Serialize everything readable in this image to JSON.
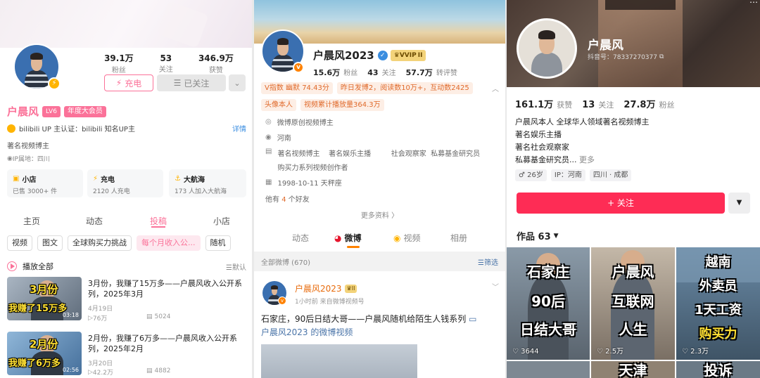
{
  "bili": {
    "stats": [
      {
        "num": "39.1万",
        "label": "粉丝"
      },
      {
        "num": "53",
        "label": "关注"
      },
      {
        "num": "346.9万",
        "label": "获赞"
      }
    ],
    "charge_btn": "充电",
    "followed_btn": "已关注",
    "more_icon": "chevron-down-icon",
    "name": "户晨风",
    "level": "LV6",
    "vip": "年度大会员",
    "cert": "bilibili UP 主认证：bilibili 知名UP主",
    "cert_detail": "详情",
    "bio": "著名视频博主",
    "ip": "IP属地：四川",
    "cards": [
      {
        "title": "小店",
        "sub": "已售 3000+ 件"
      },
      {
        "title": "充电",
        "sub": "2120 人充电"
      },
      {
        "title": "大航海",
        "sub": "173 人加入大航海"
      }
    ],
    "tabs": [
      "主页",
      "动态",
      "投稿",
      "小店"
    ],
    "filters": [
      "视频",
      "图文",
      "全球购买力挑战",
      "每个月收入公...",
      "随机"
    ],
    "play_all": "播放全部",
    "sort": "默认",
    "videos": [
      {
        "title": "3月份，我赚了15万多——户晨风收入公开系列，2025年3月",
        "date": "4月19日",
        "views": "76万",
        "danmaku": "5024",
        "dur": "03:18",
        "ov1": "3月份",
        "ov2": "我赚了15万多"
      },
      {
        "title": "2月份，我赚了6万多——户晨风收入公开系列，2025年2月",
        "date": "3月20日",
        "views": "42.2万",
        "danmaku": "4882",
        "dur": "02:56",
        "ov1": "2月份",
        "ov2": "我赚了6万多"
      }
    ]
  },
  "weibo": {
    "name": "户晨风2023",
    "vip": "VVIP",
    "vip_level": "II",
    "stats": [
      {
        "num": "15.6万",
        "label": "粉丝"
      },
      {
        "num": "43",
        "label": "关注"
      },
      {
        "num": "57.7万",
        "label": "转评赞"
      }
    ],
    "tag1": "V指数 幽默 74.43分",
    "tag2": "昨日发博2，阅读数10万+，互动数2425",
    "tag3": "头像本人",
    "tag4": "视频累计播放量364.3万",
    "info": [
      "微博原创视频博主",
      "河南",
      "著名视频博主    著名娱乐主播         社会观察家  私募基金研究员    购买力系列视频创作者",
      "1998-10-11 天秤座"
    ],
    "friends_pre": "他有",
    "friends_num": "4",
    "friends_post": "个好友",
    "more": "更多资料 〉",
    "tabs": [
      "动态",
      "微博",
      "视频",
      "相册"
    ],
    "all": "全部微博 (670)",
    "filter": "筛选",
    "post": {
      "name": "户晨风2023",
      "time": "1小时前  来自微博视频号",
      "text": "石家庄，90后日结大哥——户晨风随机给陌生人钱系列",
      "link": "户晨风2023 的微博视频"
    }
  },
  "douyin": {
    "name": "户晨风",
    "id": "抖音号：78337270377",
    "stats": [
      {
        "num": "161.1万",
        "label": "获赞"
      },
      {
        "num": "13",
        "label": "关注"
      },
      {
        "num": "27.8万",
        "label": "粉丝"
      }
    ],
    "bio": [
      "户晨风本人  全球华人领域著名视频博主",
      "著名娱乐主播",
      "著名社会观察家",
      "私募基金研究员..."
    ],
    "more": "更多",
    "age": "♂ 26岁",
    "ip": "IP：河南",
    "loc": "四川 · 成都",
    "follow": "+ 关注",
    "works": "作品 63",
    "grid": [
      {
        "lines": [
          "石家庄",
          "90后",
          "日结大哥"
        ],
        "likes": "3644"
      },
      {
        "lines": [
          "户晨风",
          "互联网",
          "人生"
        ],
        "likes": "2.5万"
      },
      {
        "lines": [
          "越南",
          "外卖员",
          "1天工资",
          "购买力"
        ],
        "likes": "2.3万"
      }
    ],
    "partial": [
      "天津",
      "投诉"
    ]
  }
}
